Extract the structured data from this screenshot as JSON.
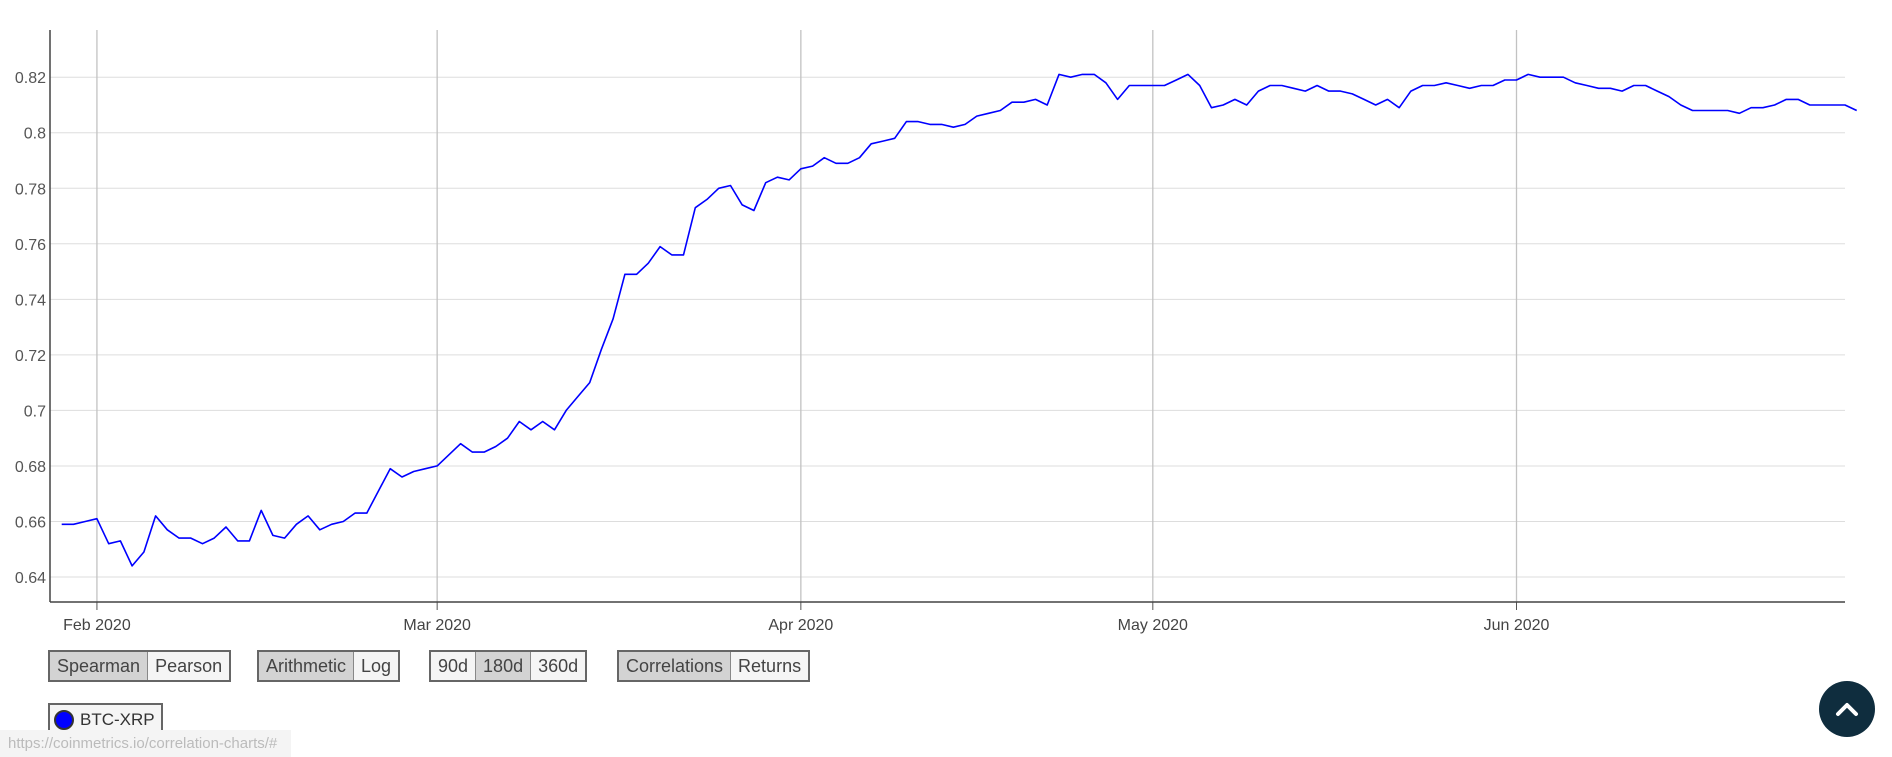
{
  "chart_data": {
    "type": "line",
    "title": "",
    "xlabel": "",
    "ylabel": "",
    "x_range": [
      "2020-01-28",
      "2020-06-29"
    ],
    "ylim": [
      0.631,
      0.837
    ],
    "y_ticks": [
      0.64,
      0.66,
      0.68,
      0.7,
      0.72,
      0.74,
      0.76,
      0.78,
      0.8,
      0.82
    ],
    "y_tick_labels": [
      "0.64",
      "0.66",
      "0.68",
      "0.7",
      "0.72",
      "0.74",
      "0.76",
      "0.78",
      "0.8",
      "0.82"
    ],
    "x_ticks": [
      {
        "date": "2020-02-01",
        "label": "Feb 2020"
      },
      {
        "date": "2020-03-01",
        "label": "Mar 2020"
      },
      {
        "date": "2020-04-01",
        "label": "Apr 2020"
      },
      {
        "date": "2020-05-01",
        "label": "May 2020"
      },
      {
        "date": "2020-06-01",
        "label": "Jun 2020"
      }
    ],
    "grid": {
      "horizontal": true,
      "vertical": true
    },
    "series": [
      {
        "name": "BTC-XRP",
        "color": "#0000ff",
        "points": [
          [
            "2020-01-29",
            0.659
          ],
          [
            "2020-01-30",
            0.659
          ],
          [
            "2020-01-31",
            0.66
          ],
          [
            "2020-02-01",
            0.661
          ],
          [
            "2020-02-02",
            0.652
          ],
          [
            "2020-02-03",
            0.653
          ],
          [
            "2020-02-04",
            0.644
          ],
          [
            "2020-02-05",
            0.649
          ],
          [
            "2020-02-06",
            0.662
          ],
          [
            "2020-02-07",
            0.657
          ],
          [
            "2020-02-08",
            0.654
          ],
          [
            "2020-02-09",
            0.654
          ],
          [
            "2020-02-10",
            0.652
          ],
          [
            "2020-02-11",
            0.654
          ],
          [
            "2020-02-12",
            0.658
          ],
          [
            "2020-02-13",
            0.653
          ],
          [
            "2020-02-14",
            0.653
          ],
          [
            "2020-02-15",
            0.664
          ],
          [
            "2020-02-16",
            0.655
          ],
          [
            "2020-02-17",
            0.654
          ],
          [
            "2020-02-18",
            0.659
          ],
          [
            "2020-02-19",
            0.662
          ],
          [
            "2020-02-20",
            0.657
          ],
          [
            "2020-02-21",
            0.659
          ],
          [
            "2020-02-22",
            0.66
          ],
          [
            "2020-02-23",
            0.663
          ],
          [
            "2020-02-24",
            0.663
          ],
          [
            "2020-02-25",
            0.671
          ],
          [
            "2020-02-26",
            0.679
          ],
          [
            "2020-02-27",
            0.676
          ],
          [
            "2020-02-28",
            0.678
          ],
          [
            "2020-02-29",
            0.679
          ],
          [
            "2020-03-01",
            0.68
          ],
          [
            "2020-03-02",
            0.684
          ],
          [
            "2020-03-03",
            0.688
          ],
          [
            "2020-03-04",
            0.685
          ],
          [
            "2020-03-05",
            0.685
          ],
          [
            "2020-03-06",
            0.687
          ],
          [
            "2020-03-07",
            0.69
          ],
          [
            "2020-03-08",
            0.696
          ],
          [
            "2020-03-09",
            0.693
          ],
          [
            "2020-03-10",
            0.696
          ],
          [
            "2020-03-11",
            0.693
          ],
          [
            "2020-03-12",
            0.7
          ],
          [
            "2020-03-13",
            0.705
          ],
          [
            "2020-03-14",
            0.71
          ],
          [
            "2020-03-15",
            0.722
          ],
          [
            "2020-03-16",
            0.733
          ],
          [
            "2020-03-17",
            0.749
          ],
          [
            "2020-03-18",
            0.749
          ],
          [
            "2020-03-19",
            0.753
          ],
          [
            "2020-03-20",
            0.759
          ],
          [
            "2020-03-21",
            0.756
          ],
          [
            "2020-03-22",
            0.756
          ],
          [
            "2020-03-23",
            0.773
          ],
          [
            "2020-03-24",
            0.776
          ],
          [
            "2020-03-25",
            0.78
          ],
          [
            "2020-03-26",
            0.781
          ],
          [
            "2020-03-27",
            0.774
          ],
          [
            "2020-03-28",
            0.772
          ],
          [
            "2020-03-29",
            0.782
          ],
          [
            "2020-03-30",
            0.784
          ],
          [
            "2020-03-31",
            0.783
          ],
          [
            "2020-04-01",
            0.787
          ],
          [
            "2020-04-02",
            0.788
          ],
          [
            "2020-04-03",
            0.791
          ],
          [
            "2020-04-04",
            0.789
          ],
          [
            "2020-04-05",
            0.789
          ],
          [
            "2020-04-06",
            0.791
          ],
          [
            "2020-04-07",
            0.796
          ],
          [
            "2020-04-08",
            0.797
          ],
          [
            "2020-04-09",
            0.798
          ],
          [
            "2020-04-10",
            0.804
          ],
          [
            "2020-04-11",
            0.804
          ],
          [
            "2020-04-12",
            0.803
          ],
          [
            "2020-04-13",
            0.803
          ],
          [
            "2020-04-14",
            0.802
          ],
          [
            "2020-04-15",
            0.803
          ],
          [
            "2020-04-16",
            0.806
          ],
          [
            "2020-04-17",
            0.807
          ],
          [
            "2020-04-18",
            0.808
          ],
          [
            "2020-04-19",
            0.811
          ],
          [
            "2020-04-20",
            0.811
          ],
          [
            "2020-04-21",
            0.812
          ],
          [
            "2020-04-22",
            0.81
          ],
          [
            "2020-04-23",
            0.821
          ],
          [
            "2020-04-24",
            0.82
          ],
          [
            "2020-04-25",
            0.821
          ],
          [
            "2020-04-26",
            0.821
          ],
          [
            "2020-04-27",
            0.818
          ],
          [
            "2020-04-28",
            0.812
          ],
          [
            "2020-04-29",
            0.817
          ],
          [
            "2020-04-30",
            0.817
          ],
          [
            "2020-05-01",
            0.817
          ],
          [
            "2020-05-02",
            0.817
          ],
          [
            "2020-05-03",
            0.819
          ],
          [
            "2020-05-04",
            0.821
          ],
          [
            "2020-05-05",
            0.817
          ],
          [
            "2020-05-06",
            0.809
          ],
          [
            "2020-05-07",
            0.81
          ],
          [
            "2020-05-08",
            0.812
          ],
          [
            "2020-05-09",
            0.81
          ],
          [
            "2020-05-10",
            0.815
          ],
          [
            "2020-05-11",
            0.817
          ],
          [
            "2020-05-12",
            0.817
          ],
          [
            "2020-05-13",
            0.816
          ],
          [
            "2020-05-14",
            0.815
          ],
          [
            "2020-05-15",
            0.817
          ],
          [
            "2020-05-16",
            0.815
          ],
          [
            "2020-05-17",
            0.815
          ],
          [
            "2020-05-18",
            0.814
          ],
          [
            "2020-05-19",
            0.812
          ],
          [
            "2020-05-20",
            0.81
          ],
          [
            "2020-05-21",
            0.812
          ],
          [
            "2020-05-22",
            0.809
          ],
          [
            "2020-05-23",
            0.815
          ],
          [
            "2020-05-24",
            0.817
          ],
          [
            "2020-05-25",
            0.817
          ],
          [
            "2020-05-26",
            0.818
          ],
          [
            "2020-05-27",
            0.817
          ],
          [
            "2020-05-28",
            0.816
          ],
          [
            "2020-05-29",
            0.817
          ],
          [
            "2020-05-30",
            0.817
          ],
          [
            "2020-05-31",
            0.819
          ],
          [
            "2020-06-01",
            0.819
          ],
          [
            "2020-06-02",
            0.821
          ],
          [
            "2020-06-03",
            0.82
          ],
          [
            "2020-06-04",
            0.82
          ],
          [
            "2020-06-05",
            0.82
          ],
          [
            "2020-06-06",
            0.818
          ],
          [
            "2020-06-07",
            0.817
          ],
          [
            "2020-06-08",
            0.816
          ],
          [
            "2020-06-09",
            0.816
          ],
          [
            "2020-06-10",
            0.815
          ],
          [
            "2020-06-11",
            0.817
          ],
          [
            "2020-06-12",
            0.817
          ],
          [
            "2020-06-13",
            0.815
          ],
          [
            "2020-06-14",
            0.813
          ],
          [
            "2020-06-15",
            0.81
          ],
          [
            "2020-06-16",
            0.808
          ],
          [
            "2020-06-17",
            0.808
          ],
          [
            "2020-06-18",
            0.808
          ],
          [
            "2020-06-19",
            0.808
          ],
          [
            "2020-06-20",
            0.807
          ],
          [
            "2020-06-21",
            0.809
          ],
          [
            "2020-06-22",
            0.809
          ],
          [
            "2020-06-23",
            0.81
          ],
          [
            "2020-06-24",
            0.812
          ],
          [
            "2020-06-25",
            0.812
          ],
          [
            "2020-06-26",
            0.81
          ],
          [
            "2020-06-27",
            0.81
          ],
          [
            "2020-06-28",
            0.81
          ],
          [
            "2020-06-29",
            0.81
          ],
          [
            "2020-06-30",
            0.808
          ]
        ]
      }
    ]
  },
  "controls": {
    "method": {
      "options": [
        "Spearman",
        "Pearson"
      ],
      "active": "Spearman"
    },
    "scale": {
      "options": [
        "Arithmetic",
        "Log"
      ],
      "active": "Arithmetic"
    },
    "window": {
      "options": [
        "90d",
        "180d",
        "360d"
      ],
      "active": "180d"
    },
    "view": {
      "options": [
        "Correlations",
        "Returns"
      ],
      "active": "Correlations"
    }
  },
  "legend": {
    "label": "BTC-XRP",
    "color": "#0000ff"
  },
  "status_bar": {
    "url": "https://coinmetrics.io/correlation-charts/#"
  },
  "scroll_top": {
    "icon": "chevron-up-icon"
  }
}
